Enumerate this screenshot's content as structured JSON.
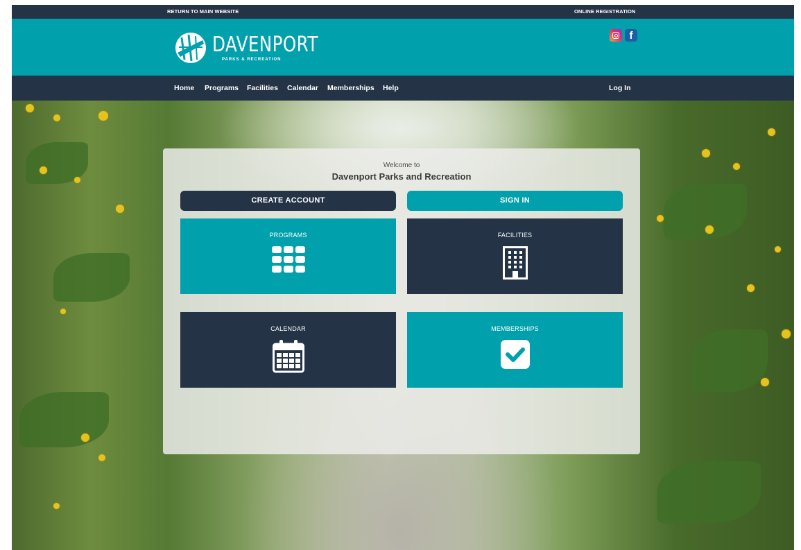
{
  "topbar": {
    "return_link": "RETURN TO MAIN WEBSITE",
    "registration_link": "ONLINE REGISTRATION"
  },
  "header": {
    "logo_name": "DAVENPORT",
    "logo_subtitle": "PARKS & RECREATION",
    "social_icons": [
      "instagram-icon",
      "facebook-icon"
    ],
    "facebook_glyph": "f"
  },
  "nav": {
    "items": [
      "Home",
      "Programs",
      "Facilities",
      "Calendar",
      "Memberships",
      "Help"
    ],
    "login": "Log In"
  },
  "panel": {
    "welcome_line": "Welcome to",
    "org_name": "Davenport Parks and Recreation",
    "create_account": "CREATE ACCOUNT",
    "sign_in": "SIGN IN",
    "tiles": [
      {
        "label": "PROGRAMS",
        "icon": "grid-icon"
      },
      {
        "label": "FACILITIES",
        "icon": "building-icon"
      },
      {
        "label": "CALENDAR",
        "icon": "calendar-icon"
      },
      {
        "label": "MEMBERSHIPS",
        "icon": "checkbox-icon"
      }
    ]
  },
  "colors": {
    "navy": "#243446",
    "teal": "#00a1ad"
  }
}
